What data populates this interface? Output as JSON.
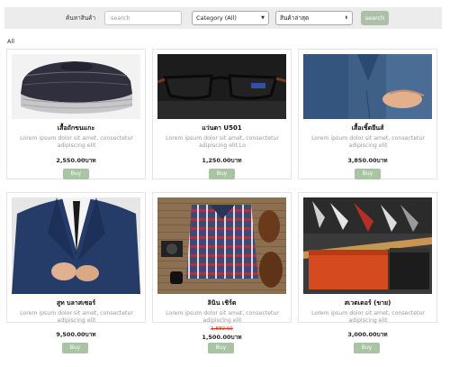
{
  "search": {
    "label": "ค้นหาสินค้า",
    "placeholder": "search",
    "category_value": "Category (All)",
    "sort_value": "สินค้าล่าสุด",
    "button_label": "search"
  },
  "filter_label": "All",
  "colors": {
    "accent_button": "#aebfa8",
    "buy_button": "#a8c4a2",
    "old_price": "#c0392b"
  },
  "products": [
    {
      "name": "เสื้อถักขนแกะ",
      "description": "Lorem ipsum dolor sit amet, consectetur adipiscing elit",
      "price": "2,550.00บาท",
      "buy": "Buy"
    },
    {
      "name": "แว่นตา U501",
      "description": "Lorem ipsum dolor sit amet, consectetur adipiscing elit.Lo",
      "price": "1,250.00บาท",
      "buy": "Buy"
    },
    {
      "name": "เสื้อเชิ้ตยีนส์",
      "description": "Lorem ipsum dolor sit amet, consectetur adipiscing elit",
      "price": "3,850.00บาท",
      "buy": "Buy"
    },
    {
      "name": "สูท บลาสเซอร์",
      "description": "Lorem ipsum dolor sit amet, consectetur adipiscing elit",
      "price": "9,500.00บาท",
      "buy": "Buy"
    },
    {
      "name": "ลินิน เชิร์ต",
      "description": "Lorem ipsum dolor sit amet, consectetur adipiscing elit",
      "old_price": "1,880.00",
      "price": "1,500.00บาท",
      "buy": "Buy"
    },
    {
      "name": "สเวตเตอร์ (ขาย)",
      "description": "Lorem ipsum dolor sit amet, consectetur adipiscing elit",
      "price": "3,000.00บาท",
      "buy": "Buy"
    }
  ]
}
